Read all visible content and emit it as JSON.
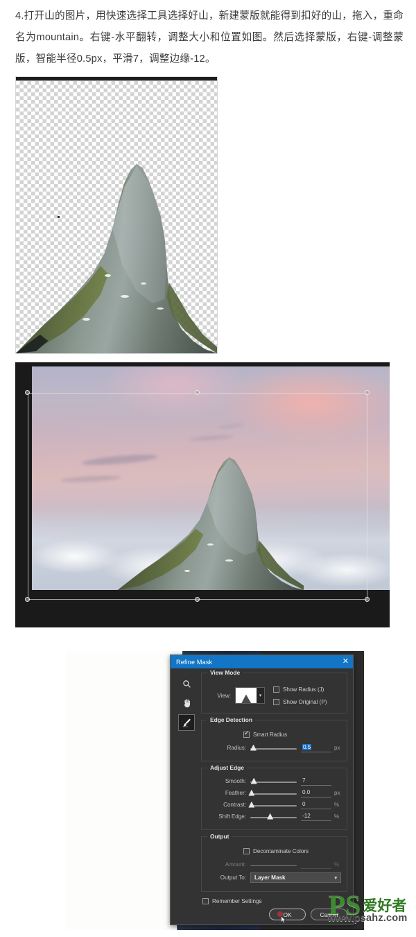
{
  "tutorial": {
    "paragraph": "4.打开山的图片，用快速选择工具选择好山，新建蒙版就能得到扣好的山，拖入，重命名为mountain。右键-水平翻转，调整大小和位置如图。然后选择蒙版，右键-调整蒙版，智能半径0.5px，平滑7，调整边缘-12。"
  },
  "figures": {
    "cutout_caption": "transparent-background mountain cutout",
    "composite_caption": "mountain composited on sunset sky with free-transform bounding box",
    "dialog_caption": "Refine Mask dialog over zoomed mask edge"
  },
  "dialog": {
    "title": "Refine Mask",
    "close_label": "✕",
    "tools": [
      {
        "name": "zoom-tool",
        "glyph": "⌕"
      },
      {
        "name": "hand-tool",
        "glyph": "✋"
      },
      {
        "name": "refine-edge-brush-tool",
        "glyph": "🖌"
      }
    ],
    "view_mode": {
      "title": "View Mode",
      "view_label": "View:",
      "thumbnail_alt": "mask preview on white",
      "caret": "▾",
      "show_radius_label": "Show Radius (J)",
      "show_radius_checked": false,
      "show_original_label": "Show Original (P)",
      "show_original_checked": false
    },
    "edge_detection": {
      "title": "Edge Detection",
      "smart_radius_label": "Smart Radius",
      "smart_radius_checked": true,
      "radius_label": "Radius:",
      "radius_value": "0.5",
      "radius_unit": "px",
      "radius_knob_pct": 6
    },
    "adjust_edge": {
      "title": "Adjust Edge",
      "rows": [
        {
          "label": "Smooth:",
          "value": "7",
          "unit": "",
          "knob_pct": 7
        },
        {
          "label": "Feather:",
          "value": "0.0",
          "unit": "px",
          "knob_pct": 2
        },
        {
          "label": "Contrast:",
          "value": "0",
          "unit": "%",
          "knob_pct": 2
        },
        {
          "label": "Shift Edge:",
          "value": "-12",
          "unit": "%",
          "knob_pct": 42
        }
      ]
    },
    "output": {
      "title": "Output",
      "decontaminate_label": "Decontaminate Colors",
      "decontaminate_checked": false,
      "amount_label": "Amount:",
      "amount_unit": "%",
      "output_to_label": "Output To:",
      "output_to_value": "Layer Mask",
      "output_to_caret": "▾"
    },
    "remember_label": "Remember Settings",
    "remember_checked": false,
    "ok_label": "OK",
    "cancel_label": "Cancel"
  },
  "watermark": {
    "brand": "PS",
    "brand_cn": "爱好者",
    "url": "www.psahz.com"
  },
  "colors": {
    "title_bar": "#1275c6",
    "dialog_bg": "#333333",
    "accent_select": "#1b6fc4",
    "watermark_green": "#3d8b2f"
  }
}
